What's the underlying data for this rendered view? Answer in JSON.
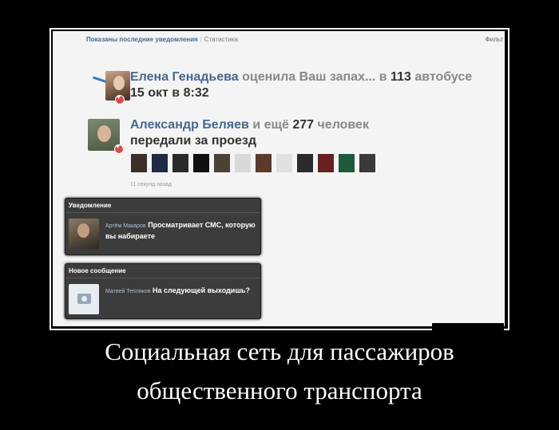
{
  "topbar": {
    "tab_active": "Показаны последние уведомления",
    "separator": "|",
    "tab_stats": "Статистика",
    "filter": "Фильт"
  },
  "notification1": {
    "name": "Елена Генадьева",
    "action": "оценила Ваш запах... в",
    "number": "113",
    "place": "автобусе",
    "date": "15 окт в 8:32"
  },
  "notification2": {
    "name": "Александр Беляев",
    "middle": "и ещё",
    "count": "277",
    "people": "человек",
    "action": "передали за проезд",
    "time": "11 секунд назад"
  },
  "popup1": {
    "title": "Уведомление",
    "sender": "Артём Макаров",
    "text": "Просматривает СМС, которую вы набираете"
  },
  "popup2": {
    "title": "Новое сообщение",
    "sender": "Матвей Тепляков",
    "text": "На следующей выходишь?"
  },
  "caption": {
    "line1": "Социальная сеть для пассажиров",
    "line2": "общественного транспорта"
  },
  "colors": {
    "link": "#45688e",
    "popup_bg": "#3c3c3c",
    "heart": "#d94b4b"
  },
  "thumb_colors": [
    "#3b2f28",
    "#1f2a44",
    "#2a2a2a",
    "#111111",
    "#4a4235",
    "#d8d8d8",
    "#5a3b2a",
    "#e0e0e0",
    "#2b2b2b",
    "#6b1f1f",
    "#1e5a3a",
    "#3a3a3a"
  ]
}
